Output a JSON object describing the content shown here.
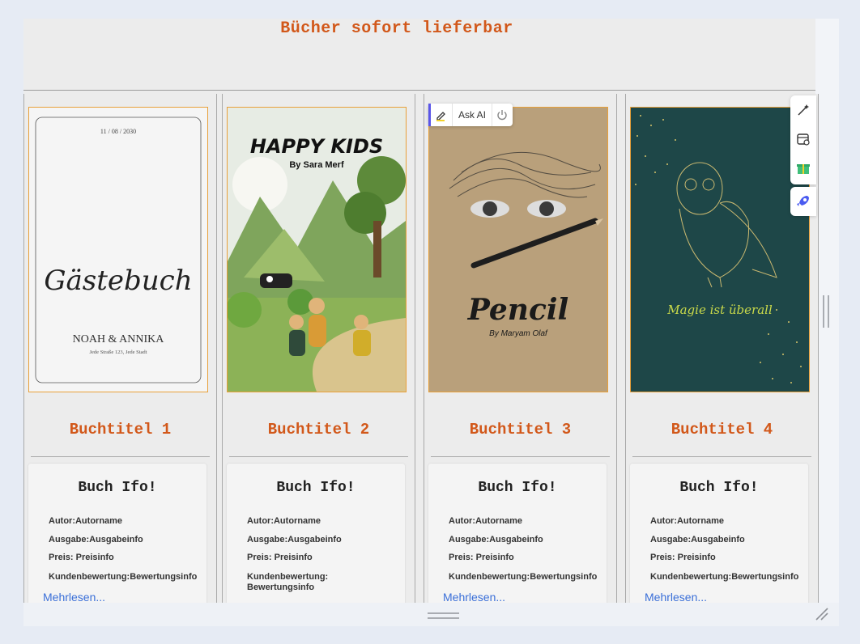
{
  "header": {
    "title": "Bücher sofort lieferbar"
  },
  "toolbar": {
    "ask_ai_label": "Ask AI"
  },
  "covers": {
    "guestbook": {
      "date": "11 / 08 / 2030",
      "script_title": "Gästebuch",
      "names": "NOAH & ANNIKA",
      "address": "Jede Straße 123, Jede Stadt"
    },
    "happy_kids": {
      "title": "HAPPY KIDS",
      "byline": "By Sara Merf"
    },
    "pencil": {
      "title": "Pencil",
      "byline": "By Maryam Olaf"
    },
    "owl": {
      "tagline": "Magie ist überall"
    }
  },
  "books": [
    {
      "title": "Buchtitel 1",
      "info_heading": "Buch Ifo!",
      "author": "Autor:Autorname",
      "edition": "Ausgabe:Ausgabeinfo",
      "price": "Preis: Preisinfo",
      "rating": "Kundenbewertung:Bewertungsinfo",
      "more": "Mehrlesen..."
    },
    {
      "title": "Buchtitel 2",
      "info_heading": "Buch Ifo!",
      "author": "Autor:Autorname",
      "edition": "Ausgabe:Ausgabeinfo",
      "price": "Preis: Preisinfo",
      "rating_line1": "Kundenbewertung:",
      "rating_line2": "Bewertungsinfo"
    },
    {
      "title": "Buchtitel 3",
      "info_heading": "Buch Ifo!",
      "author": "Autor:Autorname",
      "edition": "Ausgabe:Ausgabeinfo",
      "price": "Preis: Preisinfo",
      "rating": "Kundenbewertung:Bewertungsinfo",
      "more": "Mehrlesen..."
    },
    {
      "title": "Buchtitel 4",
      "info_heading": "Buch Ifo!",
      "author": "Autor:Autorname",
      "edition": "Ausgabe:Ausgabeinfo",
      "price": "Preis: Preisinfo",
      "rating": "Kundenbewertung:Bewertungsinfo",
      "more": "Mehrlesen..."
    }
  ],
  "colors": {
    "accent_orange": "#d2581a",
    "cover_border": "#e8a03a",
    "link_blue": "#3a6fd8",
    "owl_bg": "#1e4748"
  }
}
